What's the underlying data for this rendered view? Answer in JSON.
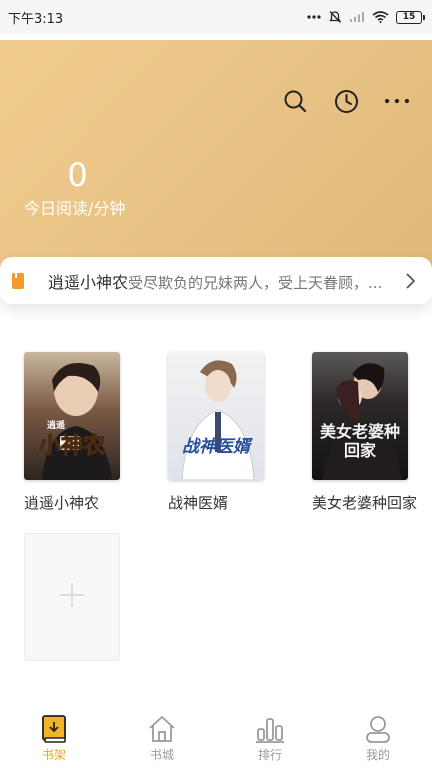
{
  "status_bar": {
    "time": "下午3:13",
    "battery": "15",
    "icons": [
      "more-dots-icon",
      "dnd-off-icon",
      "signal-icon",
      "wifi-icon",
      "battery-icon"
    ]
  },
  "header": {
    "read_count": "0",
    "read_label": "今日阅读/分钟",
    "actions": [
      "search-icon",
      "history-clock-icon",
      "more-icon"
    ],
    "colors": {
      "gradient_start": "#f0cc8c",
      "gradient_end": "#dfb877"
    }
  },
  "recommendation": {
    "book_title": "逍遥小神农",
    "description": "受尽欺负的兄妹两人，受上天眷顾，...",
    "icon": "bookmark-icon"
  },
  "books": [
    {
      "title": "逍遥小神农",
      "cover_text": "小神农",
      "cover_subtext": "逍遥"
    },
    {
      "title": "战神医婿",
      "cover_text": "战神医婿"
    },
    {
      "title": "美女老婆种回家",
      "cover_text": "美女老婆种回家"
    }
  ],
  "add_book": {
    "icon": "plus-icon"
  },
  "nav": {
    "items": [
      {
        "label": "书架",
        "icon": "bookshelf-icon",
        "active": true
      },
      {
        "label": "书城",
        "icon": "home-icon",
        "active": false
      },
      {
        "label": "排行",
        "icon": "ranking-icon",
        "active": false
      },
      {
        "label": "我的",
        "icon": "profile-icon",
        "active": false
      }
    ],
    "colors": {
      "active": "#e6a81e",
      "inactive": "#9b9b9b"
    }
  }
}
